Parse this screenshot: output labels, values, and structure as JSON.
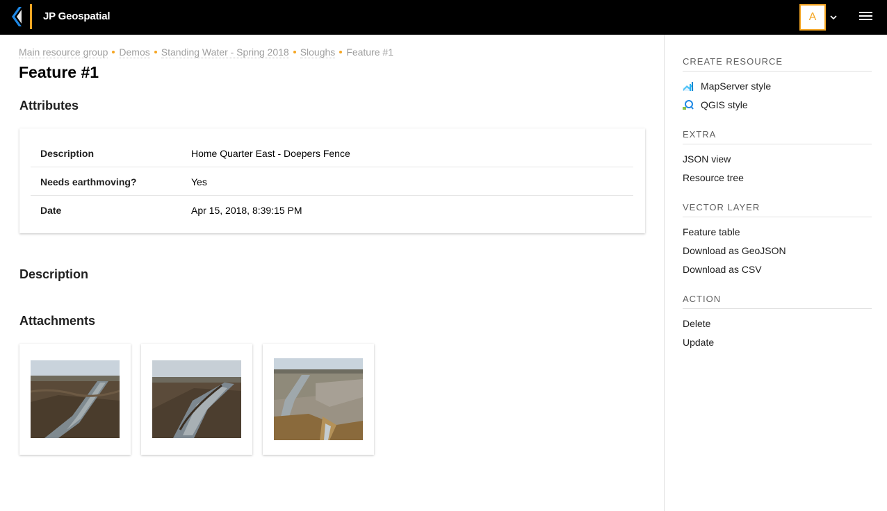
{
  "header": {
    "app_title": "JP Geospatial",
    "avatar_letter": "A",
    "brand_color": "#f5a623",
    "logo_colors": [
      "#1e88e5",
      "#ffffff"
    ]
  },
  "breadcrumb": {
    "items": [
      "Main resource group",
      "Demos",
      "Standing Water - Spring 2018",
      "Sloughs",
      "Feature #1"
    ]
  },
  "page_title": "Feature #1",
  "sections": {
    "attributes": "Attributes",
    "description": "Description",
    "attachments": "Attachments"
  },
  "attributes": [
    {
      "key": "Description",
      "value": "Home Quarter East - Doepers Fence"
    },
    {
      "key": "Needs earthmoving?",
      "value": "Yes"
    },
    {
      "key": "Date",
      "value": "Apr 15, 2018, 8:39:15 PM"
    }
  ],
  "attachments": [
    {
      "kind": "photo",
      "subject": "muddy slough with water channel"
    },
    {
      "kind": "photo",
      "subject": "muddy slough with water channel"
    },
    {
      "kind": "photo",
      "subject": "water channel through field"
    }
  ],
  "sidebar": {
    "create_resource": {
      "heading": "CREATE RESOURCE",
      "items": [
        {
          "label": "MapServer style",
          "icon": "mapserver-style-icon"
        },
        {
          "label": "QGIS style",
          "icon": "qgis-style-icon"
        }
      ]
    },
    "extra": {
      "heading": "EXTRA",
      "items": [
        "JSON view",
        "Resource tree"
      ]
    },
    "vector_layer": {
      "heading": "VECTOR LAYER",
      "items": [
        "Feature table",
        "Download as GeoJSON",
        "Download as CSV"
      ]
    },
    "action": {
      "heading": "ACTION",
      "items": [
        "Delete",
        "Update"
      ]
    }
  }
}
